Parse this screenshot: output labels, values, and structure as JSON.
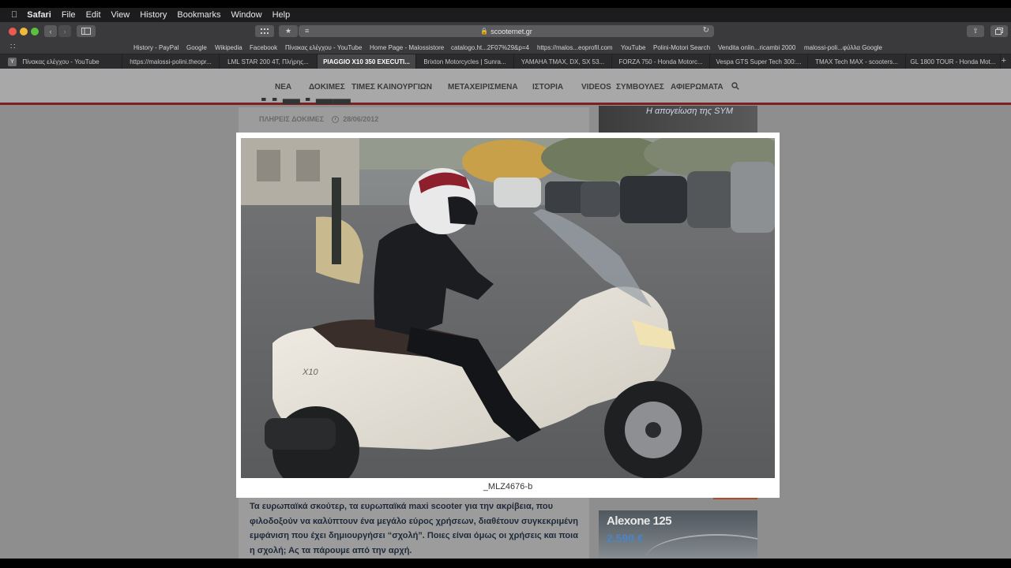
{
  "menubar": {
    "items": [
      "Safari",
      "File",
      "Edit",
      "View",
      "History",
      "Bookmarks",
      "Window",
      "Help"
    ]
  },
  "toolbar": {
    "url": "scooternet.gr"
  },
  "favorites": [
    "History - PayPal",
    "Google",
    "Wikipedia",
    "Facebook",
    "Πίνακας ελέγχου - YouTube",
    "Home Page - Malossistore",
    "catalogo.ht...2F07%29&p=4",
    "https://malos...eoprofil.com",
    "YouTube",
    "Polini-Motori Search",
    "Vendita onlin...ricambi 2000",
    "malossi-poli...φύλλα Google"
  ],
  "tabs": [
    "Πίνακας ελέγχου - YouTube",
    "https://malossi-polini.theopr...",
    "LML STAR 200 4T, Πλήρης...",
    "PIAGGIO X10 350 EXECUTI...",
    "Brixton Motorcycles | Sunra...",
    "YAMAHA TMAX, DX, SX 53...",
    "FORZA 750 - Honda Motorc...",
    "Vespa GTS Super Tech 300:...",
    "TMAX Tech MAX - scooters...",
    "GL 1800 TOUR - Honda Mot..."
  ],
  "site": {
    "nav": [
      "ΝΕΑ",
      "ΔΟΚΙΜΕΣ",
      "ΤΙΜΕΣ ΚΑΙΝΟΥΡΓΙΩΝ",
      "ΜΕΤΑΧΕΙΡΙΣΜΕΝΑ",
      "ΙΣΤΟΡΙΑ",
      "VIDEOS",
      "ΣΥΜΒΟΥΛΕΣ",
      "ΑΦΙΕΡΩΜΑΤΑ"
    ],
    "category": "ΠΛΗΡΕΙΣ ΔΟΚΙΜΕΣ",
    "date": "28/06/2012",
    "side_ad_top": "Η απογείωση της SYM",
    "side_ad_bottom_name": "Alexone 125",
    "side_ad_bottom_price": "2.590 €",
    "article_text": "Τα ευρωπαϊκά σκούτερ, τα ευρωπαϊκά maxi scooter για την ακρίβεια, που φιλοδοξούν να καλύπτουν ένα μεγάλο εύρος χρήσεων, διαθέτουν συγκεκριμένη εμφάνιση που έχει δημιουργήσει “σχολή”. Ποιες είναι όμως οι χρήσεις και ποια η σχολή; Ας τα πάρουμε από την αρχή."
  },
  "lightbox": {
    "caption": "_MLZ4676-b",
    "scooter_badge": "X10"
  },
  "colors": {
    "nav_accent": "#7d2020",
    "active_tab": "#464648",
    "price_blue": "#4a86c6"
  }
}
